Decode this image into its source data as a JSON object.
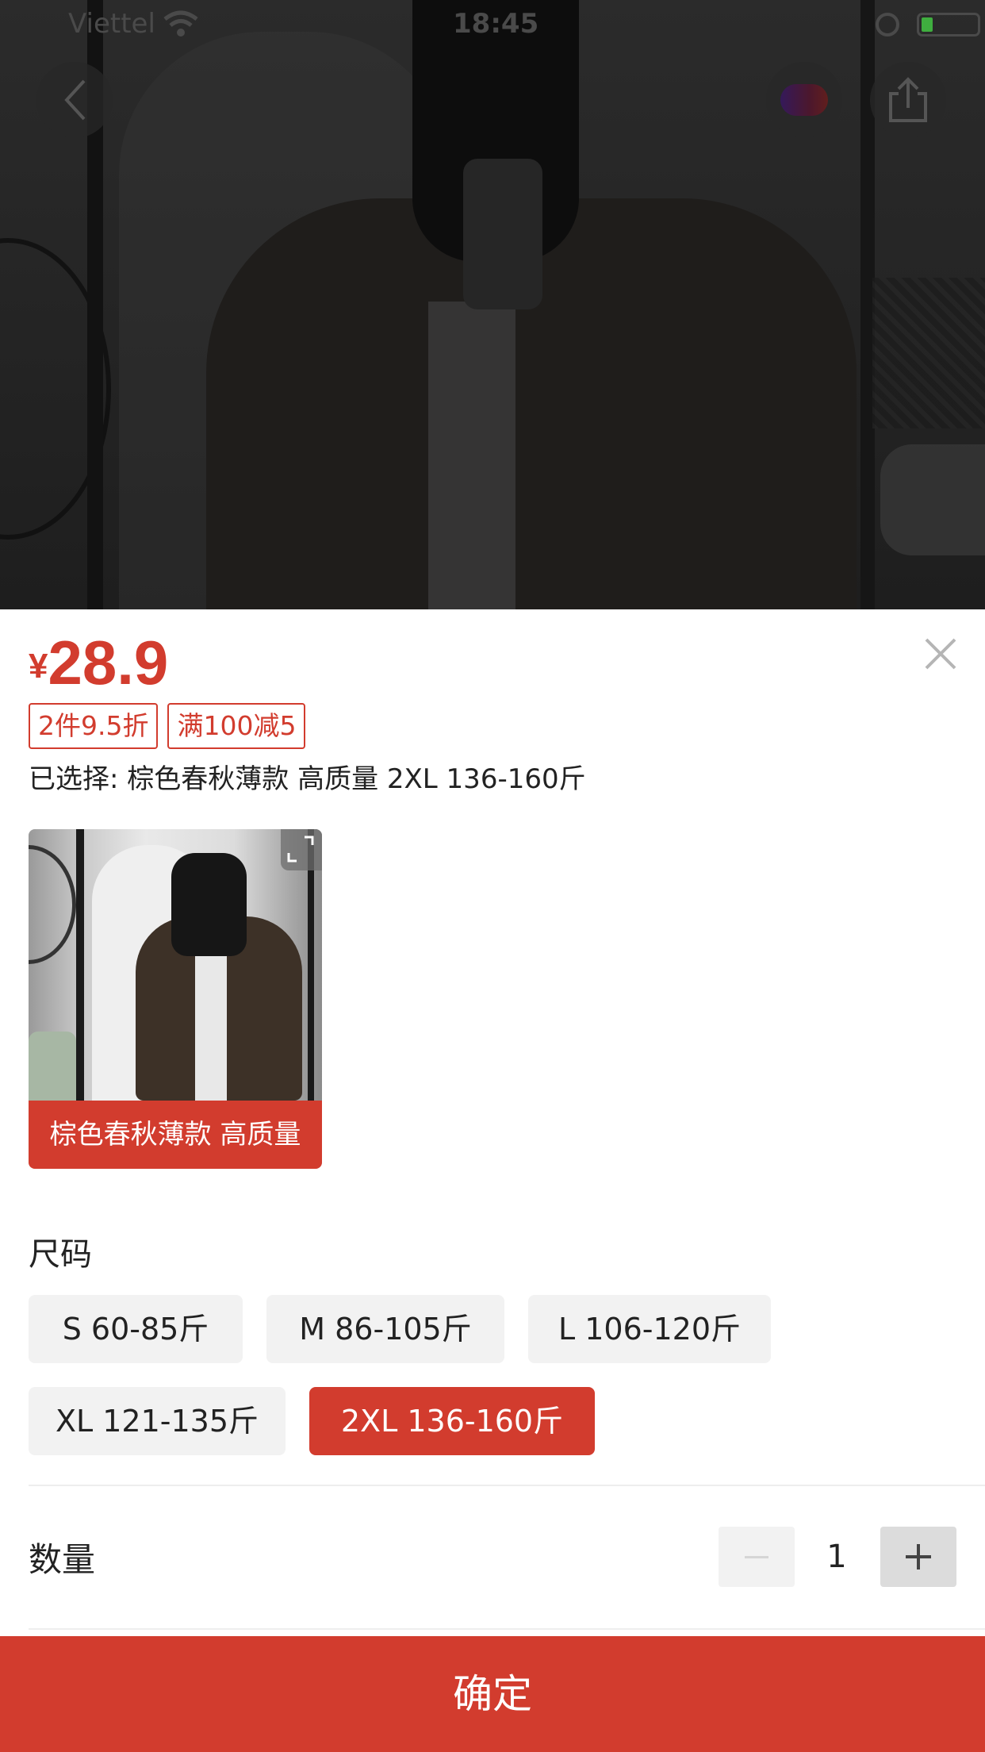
{
  "status_bar": {
    "carrier": "Viettel",
    "time": "18:45"
  },
  "icons": {
    "back": "chevron-left-icon",
    "share": "share-icon",
    "close": "close-icon",
    "expand": "expand-icon"
  },
  "product": {
    "currency": "¥",
    "price": "28.9",
    "promo_tags": [
      "2件9.5折",
      "满100减5"
    ],
    "selected_text": "已选择: 棕色春秋薄款 高质量 2XL 136-160斤"
  },
  "color_options": [
    {
      "label": "棕色春秋薄款 高质量",
      "selected": true
    }
  ],
  "size_section": {
    "title": "尺码",
    "options": [
      {
        "label": "S 60-85斤",
        "selected": false
      },
      {
        "label": "M 86-105斤",
        "selected": false
      },
      {
        "label": "L 106-120斤",
        "selected": false
      },
      {
        "label": "XL 121-135斤",
        "selected": false
      },
      {
        "label": "2XL 136-160斤",
        "selected": true
      }
    ]
  },
  "quantity": {
    "label": "数量",
    "value": "1"
  },
  "confirm_label": "确定",
  "colors": {
    "accent": "#d23c2e",
    "chip_bg": "#f2f2f2"
  }
}
